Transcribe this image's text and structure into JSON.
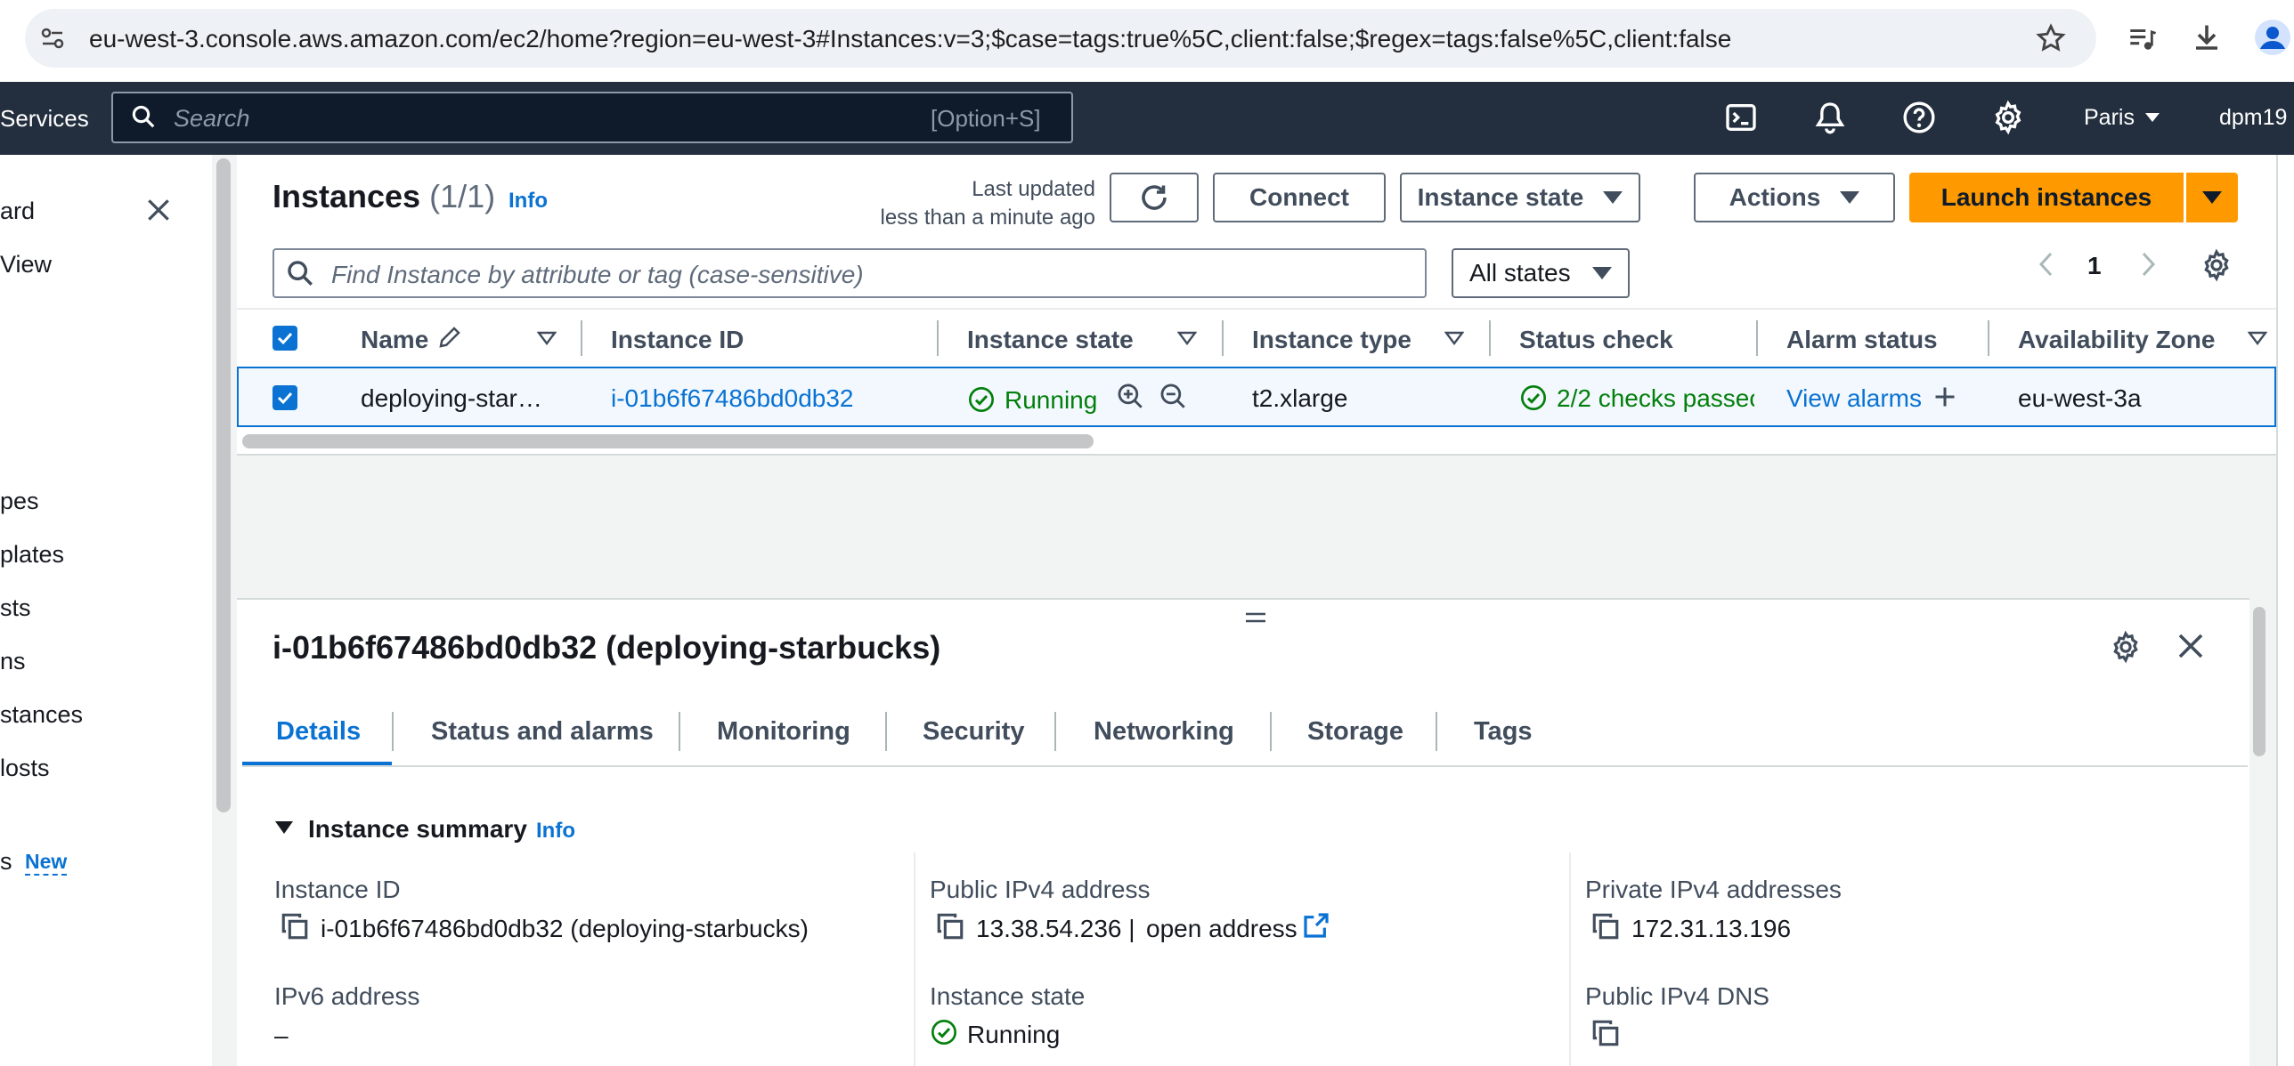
{
  "browser": {
    "url": "eu-west-3.console.aws.amazon.com/ec2/home?region=eu-west-3#Instances:v=3;$case=tags:true%5C,client:false;$regex=tags:false%5C,client:false"
  },
  "aws_header": {
    "services_label": "Services",
    "search_placeholder": "Search",
    "search_shortcut": "[Option+S]",
    "region": "Paris",
    "user": "dpm19"
  },
  "sidebar": {
    "items": [
      "ard",
      "View",
      "pes",
      "plates",
      "sts",
      "ns",
      "stances",
      "losts",
      "s"
    ],
    "new_badge": "New"
  },
  "instances_panel": {
    "title": "Instances",
    "count": "(1/1)",
    "info_link": "Info",
    "last_updated_line1": "Last updated",
    "last_updated_line2": "less than a minute ago",
    "connect_label": "Connect",
    "instance_state_label": "Instance state",
    "actions_label": "Actions",
    "launch_label": "Launch instances",
    "filter_placeholder": "Find Instance by attribute or tag (case-sensitive)",
    "states_filter": "All states",
    "page_number": "1",
    "columns": [
      "Name",
      "Instance ID",
      "Instance state",
      "Instance type",
      "Status check",
      "Alarm status",
      "Availability Zone"
    ],
    "rows": [
      {
        "name": "deploying-star…",
        "instance_id": "i-01b6f67486bd0db32",
        "state": "Running",
        "type": "t2.xlarge",
        "status_check": "2/2 checks passec",
        "alarm": "View alarms",
        "az": "eu-west-3a"
      }
    ]
  },
  "details": {
    "title": "i-01b6f67486bd0db32 (deploying-starbucks)",
    "tabs": [
      "Details",
      "Status and alarms",
      "Monitoring",
      "Security",
      "Networking",
      "Storage",
      "Tags"
    ],
    "active_tab": "Details",
    "section_title": "Instance summary",
    "section_info": "Info",
    "fields": {
      "instance_id_label": "Instance ID",
      "instance_id_value": "i-01b6f67486bd0db32 (deploying-starbucks)",
      "public_ipv4_label": "Public IPv4 address",
      "public_ipv4_value": "13.38.54.236 |",
      "open_address": "open address",
      "private_ipv4_label": "Private IPv4 addresses",
      "private_ipv4_value": "172.31.13.196",
      "ipv6_label": "IPv6 address",
      "ipv6_value": "–",
      "state_label": "Instance state",
      "state_value": "Running",
      "public_dns_label": "Public IPv4 DNS"
    }
  },
  "colors": {
    "aws_header": "#232f3e",
    "primary_orange": "#ff9900",
    "link_blue": "#0972d3",
    "success_green": "#037f0c"
  }
}
